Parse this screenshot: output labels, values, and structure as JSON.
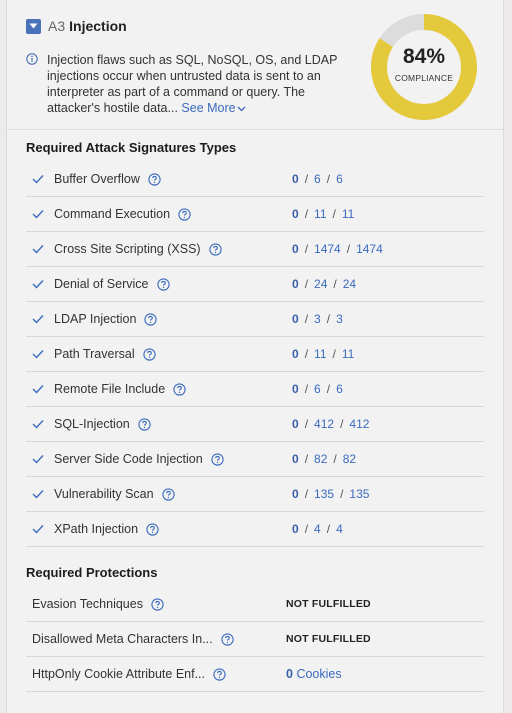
{
  "header": {
    "code": "A3",
    "name": "Injection",
    "description": "Injection flaws such as SQL, NoSQL, OS, and LDAP injections occur when untrusted data is sent to an interpreter as part of a command or query. The attacker's hostile data...",
    "see_more": "See More"
  },
  "gauge": {
    "percent_text": "84%",
    "label": "COMPLIANCE",
    "value": 0.84,
    "fill_color": "#e5c93c",
    "track_color": "#dcdcdc"
  },
  "signatures": {
    "title": "Required Attack Signatures Types",
    "items": [
      {
        "name": "Buffer Overflow",
        "a": "0",
        "b": "6",
        "c": "6"
      },
      {
        "name": "Command Execution",
        "a": "0",
        "b": "11",
        "c": "11"
      },
      {
        "name": "Cross Site Scripting (XSS)",
        "a": "0",
        "b": "1474",
        "c": "1474"
      },
      {
        "name": "Denial of Service",
        "a": "0",
        "b": "24",
        "c": "24"
      },
      {
        "name": "LDAP Injection",
        "a": "0",
        "b": "3",
        "c": "3"
      },
      {
        "name": "Path Traversal",
        "a": "0",
        "b": "11",
        "c": "11"
      },
      {
        "name": "Remote File Include",
        "a": "0",
        "b": "6",
        "c": "6"
      },
      {
        "name": "SQL-Injection",
        "a": "0",
        "b": "412",
        "c": "412"
      },
      {
        "name": "Server Side Code Injection",
        "a": "0",
        "b": "82",
        "c": "82"
      },
      {
        "name": "Vulnerability Scan",
        "a": "0",
        "b": "135",
        "c": "135"
      },
      {
        "name": "XPath Injection",
        "a": "0",
        "b": "4",
        "c": "4"
      }
    ]
  },
  "protections": {
    "title": "Required Protections",
    "items": [
      {
        "name": "Evasion Techniques",
        "status": "NOT FULFILLED"
      },
      {
        "name": "Disallowed Meta Characters In...",
        "status": "NOT FULFILLED"
      },
      {
        "name": "HttpOnly Cookie Attribute Enf...",
        "count": "0",
        "unit": "Cookies"
      }
    ]
  }
}
